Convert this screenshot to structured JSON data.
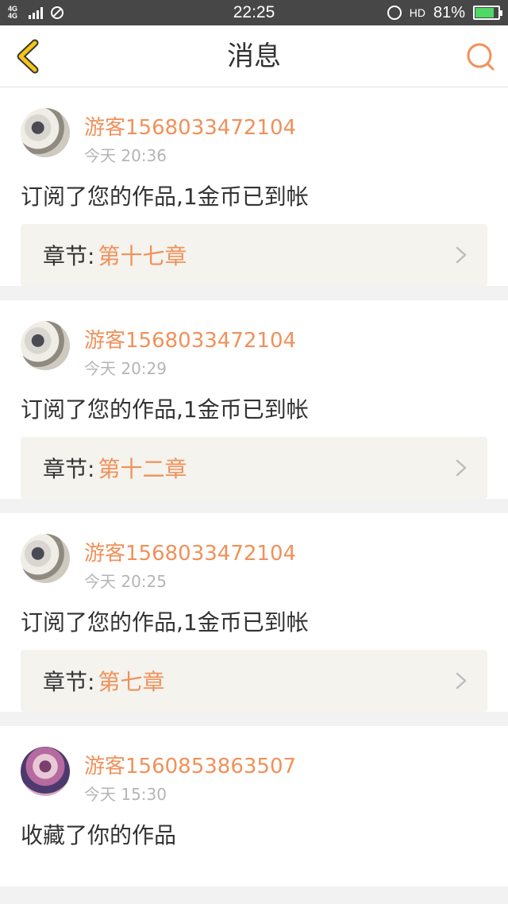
{
  "status_bar": {
    "network": "4G 4G",
    "time": "22:25",
    "hd": "HD",
    "battery": "81%",
    "battery_level": 0.81
  },
  "header": {
    "title": "消息"
  },
  "messages": [
    {
      "user": "游客1568033472104",
      "time": "今天 20:36",
      "text": "订阅了您的作品,1金币已到帐",
      "chapter_label": "章节:",
      "chapter_name": "第十七章"
    },
    {
      "user": "游客1568033472104",
      "time": "今天 20:29",
      "text": "订阅了您的作品,1金币已到帐",
      "chapter_label": "章节:",
      "chapter_name": "第十二章"
    },
    {
      "user": "游客1568033472104",
      "time": "今天 20:25",
      "text": "订阅了您的作品,1金币已到帐",
      "chapter_label": "章节:",
      "chapter_name": "第七章"
    },
    {
      "user": "游客1560853863507",
      "time": "今天 15:30",
      "text": "收藏了你的作品"
    }
  ],
  "icons": {
    "back": "chevron-left-icon",
    "search": "search-icon",
    "chapter_arrow": "chevron-right-icon"
  },
  "colors": {
    "accent": "#f0915a",
    "back_icon": "#f5c518",
    "status_bar_bg": "#474747"
  }
}
